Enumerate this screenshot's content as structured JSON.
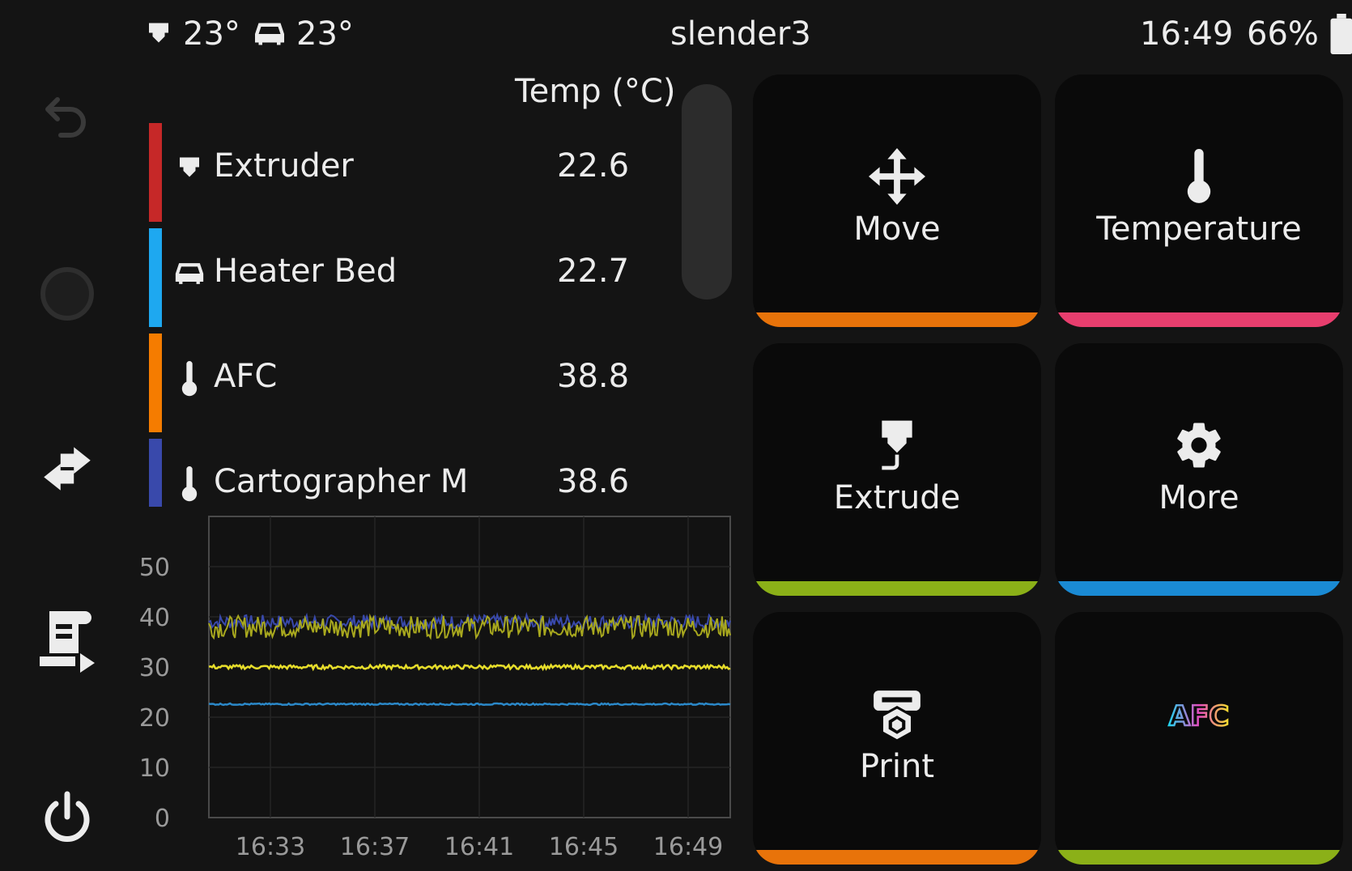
{
  "topbar": {
    "extruder_temp": "23°",
    "bed_temp": "23°",
    "printer_name": "slender3",
    "time": "16:49",
    "battery": "66%"
  },
  "temp_panel": {
    "header": "Temp (°C)",
    "rows": [
      {
        "name": "Extruder",
        "value": "22.6",
        "color": "#c62828",
        "icon": "extruder-icon"
      },
      {
        "name": "Heater Bed",
        "value": "22.7",
        "color": "#1ea8f0",
        "icon": "bed-icon"
      },
      {
        "name": "AFC",
        "value": "38.8",
        "color": "#f57c00",
        "icon": "thermometer-icon"
      },
      {
        "name": "Cartographer M",
        "value": "38.6",
        "color": "#3949ab",
        "icon": "thermometer-icon"
      }
    ]
  },
  "chart_data": {
    "type": "line",
    "x_ticks": [
      "16:33",
      "16:37",
      "16:41",
      "16:45",
      "16:49"
    ],
    "y_ticks": [
      0,
      10,
      20,
      30,
      40,
      50
    ],
    "ylim": [
      0,
      60
    ],
    "series": [
      {
        "color": "#3949ab",
        "level": 39.0,
        "noise": 1.4
      },
      {
        "color": "#a8a81e",
        "level": 38.0,
        "noise": 2.2
      },
      {
        "color": "#e6dd2a",
        "level": 30.0,
        "noise": 0.4
      },
      {
        "color": "#2b88c8",
        "level": 22.6,
        "noise": 0.15
      }
    ]
  },
  "actions": {
    "move": {
      "label": "Move",
      "color": "#e8730a"
    },
    "temperature": {
      "label": "Temperature",
      "color": "#e83e6e"
    },
    "extrude": {
      "label": "Extrude",
      "color": "#8bb018"
    },
    "more": {
      "label": "More",
      "color": "#1a8ad4"
    },
    "print": {
      "label": "Print",
      "color": "#e8730a"
    },
    "afc": {
      "logo_text": "AFC",
      "color": "#8bb018"
    }
  }
}
